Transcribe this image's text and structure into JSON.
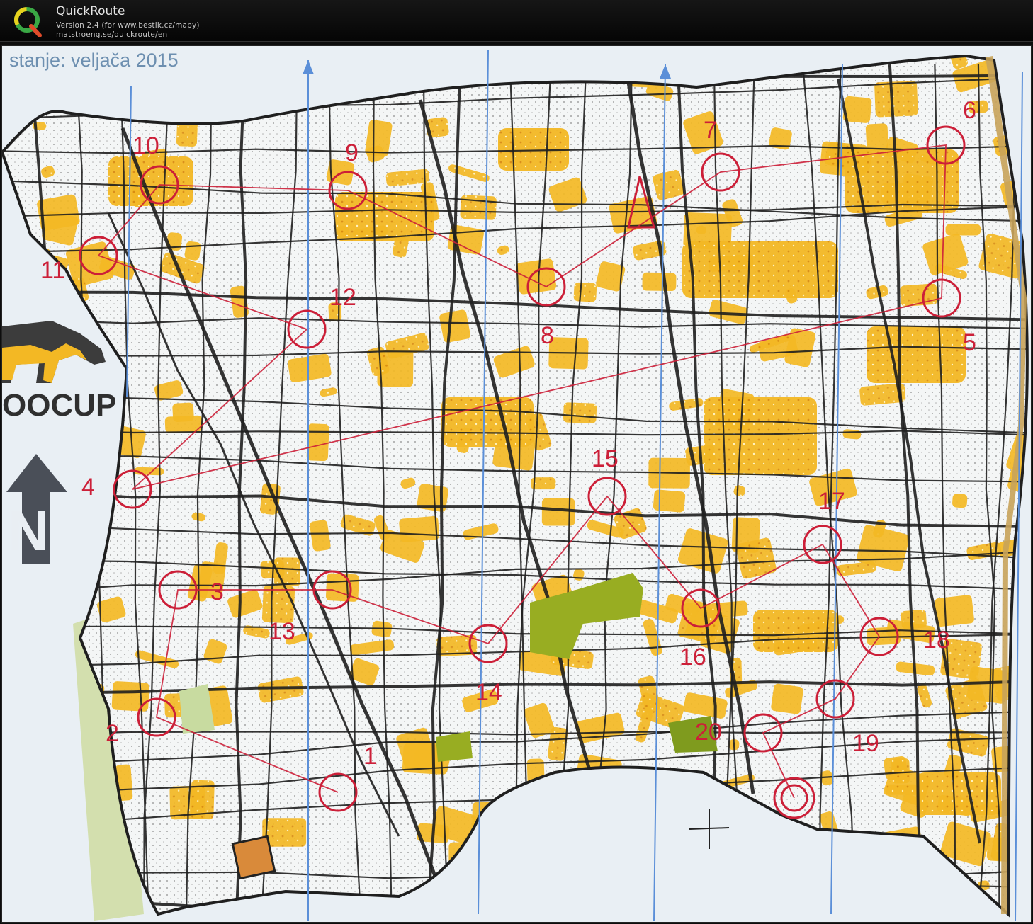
{
  "app": {
    "name": "QuickRoute",
    "version": "Version 2.4  (for www.bestik.cz/mapy)",
    "url": "matstroeng.se/quickroute/en",
    "logo_letter": "Q"
  },
  "map": {
    "date_label": "stanje: veljača 2015",
    "sponsor_label": "OOCUP",
    "north_marker": "N",
    "colors": {
      "paper": "#eef3f7",
      "open_yellow": "#f3b824",
      "green": "#98ad22",
      "course_red": "#cc1f38",
      "north_line": "#5b8fd8",
      "track_black": "#1f1f1f"
    },
    "controls": [
      {
        "label": "1"
      },
      {
        "label": "2"
      },
      {
        "label": "3"
      },
      {
        "label": "4"
      },
      {
        "label": "5"
      },
      {
        "label": "6"
      },
      {
        "label": "7"
      },
      {
        "label": "8"
      },
      {
        "label": "9"
      },
      {
        "label": "10"
      },
      {
        "label": "11"
      },
      {
        "label": "12"
      },
      {
        "label": "13"
      },
      {
        "label": "14"
      },
      {
        "label": "15"
      },
      {
        "label": "16"
      },
      {
        "label": "17"
      },
      {
        "label": "18"
      },
      {
        "label": "19"
      },
      {
        "label": "20"
      }
    ]
  }
}
